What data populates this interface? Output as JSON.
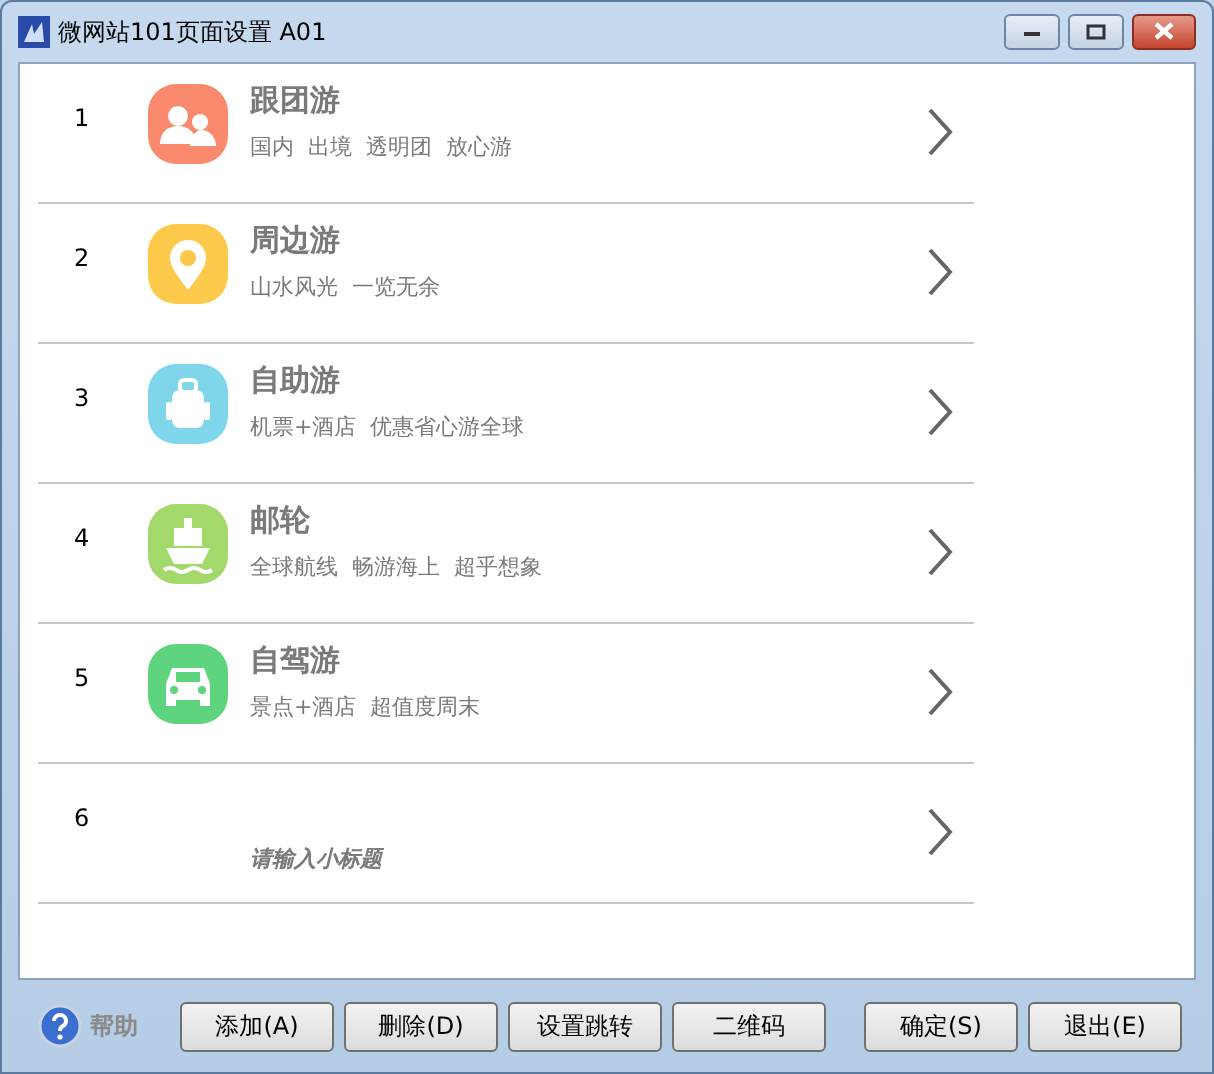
{
  "window": {
    "title": "微网站101页面设置 A01"
  },
  "items": [
    {
      "number": "1",
      "kind": "people",
      "color": "#f98a6e",
      "title": "跟团游",
      "subtitle": "国内  出境  透明团  放心游"
    },
    {
      "number": "2",
      "kind": "pin",
      "color": "#fdc94a",
      "title": "周边游",
      "subtitle": "山水风光  一览无余"
    },
    {
      "number": "3",
      "kind": "backpack",
      "color": "#7fd6ea",
      "title": "自助游",
      "subtitle": "机票+酒店  优惠省心游全球"
    },
    {
      "number": "4",
      "kind": "ship",
      "color": "#a3d86a",
      "title": "邮轮",
      "subtitle": "全球航线  畅游海上  超乎想象"
    },
    {
      "number": "5",
      "kind": "car",
      "color": "#5fd47e",
      "title": "自驾游",
      "subtitle": "景点+酒店  超值度周末"
    },
    {
      "number": "6",
      "placeholder": "请输入小标题"
    }
  ],
  "help": "帮助",
  "buttons": [
    "添加(A)",
    "删除(D)",
    "设置跳转",
    "二维码",
    "确定(S)",
    "退出(E)"
  ]
}
